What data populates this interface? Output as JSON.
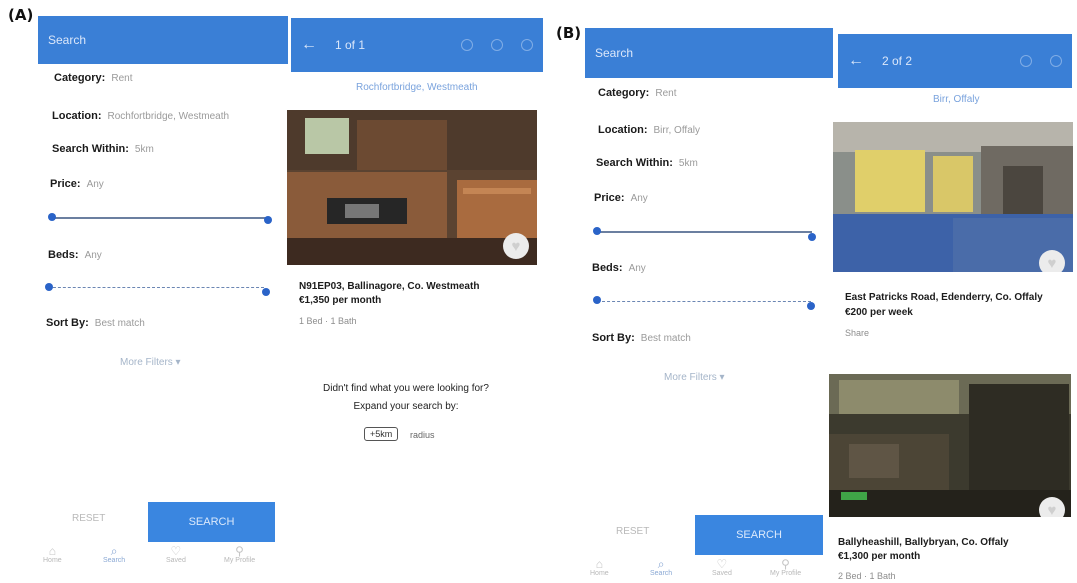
{
  "panels": {
    "a": "(A)",
    "b": "(B)"
  },
  "colors": {
    "header": "#3a7fd6",
    "accent": "#2a63c8",
    "search_button": "#3a86e0"
  },
  "A": {
    "search_header": {
      "title": "Search"
    },
    "form": {
      "category": {
        "label": "Category:",
        "value": "Rent"
      },
      "location": {
        "label": "Location:",
        "value": "Rochfortbridge, Westmeath"
      },
      "search_within": {
        "label": "Search Within:",
        "value": "5km"
      },
      "price": {
        "label": "Price:",
        "value": "Any"
      },
      "beds": {
        "label": "Beds:",
        "value": "Any"
      },
      "sort_by": {
        "label": "Sort By:",
        "value": "Best match"
      },
      "more_filters": "More Filters ▾"
    },
    "actions": {
      "reset": "RESET",
      "search": "SEARCH"
    },
    "tabs": [
      "Home",
      "Search",
      "Saved",
      "My Profile"
    ],
    "results": {
      "nav": {
        "back": "←",
        "title": "1 of 1"
      },
      "subheader": "Rochfortbridge, Westmeath",
      "listing": {
        "address": "N91EP03, Ballinagore, Co. Westmeath",
        "price": "€1,350 per month",
        "meta": "1 Bed · 1 Bath"
      },
      "empty_line1": "Didn't find what you were looking for?",
      "empty_line2": "Expand your search by:",
      "chip": "+5km",
      "chip_suffix": "radius"
    }
  },
  "B": {
    "search_header": {
      "title": "Search"
    },
    "form": {
      "category": {
        "label": "Category:",
        "value": "Rent"
      },
      "location": {
        "label": "Location:",
        "value": "Birr, Offaly"
      },
      "search_within": {
        "label": "Search Within:",
        "value": "5km"
      },
      "price": {
        "label": "Price:",
        "value": "Any"
      },
      "beds": {
        "label": "Beds:",
        "value": "Any"
      },
      "sort_by": {
        "label": "Sort By:",
        "value": "Best match"
      },
      "more_filters": "More Filters ▾"
    },
    "actions": {
      "reset": "RESET",
      "search": "SEARCH"
    },
    "tabs": [
      "Home",
      "Search",
      "Saved",
      "My Profile"
    ],
    "results": {
      "nav": {
        "back": "←",
        "title": "2 of 2"
      },
      "subheader": "Birr, Offaly",
      "listing1": {
        "address": "East Patricks Road, Edenderry, Co. Offaly",
        "price": "€200 per week",
        "meta": "Share"
      },
      "listing2": {
        "address": "Ballyheashill, Ballybryan, Co. Offaly",
        "price": "€1,300 per month",
        "meta": "2 Bed · 1 Bath"
      }
    }
  }
}
